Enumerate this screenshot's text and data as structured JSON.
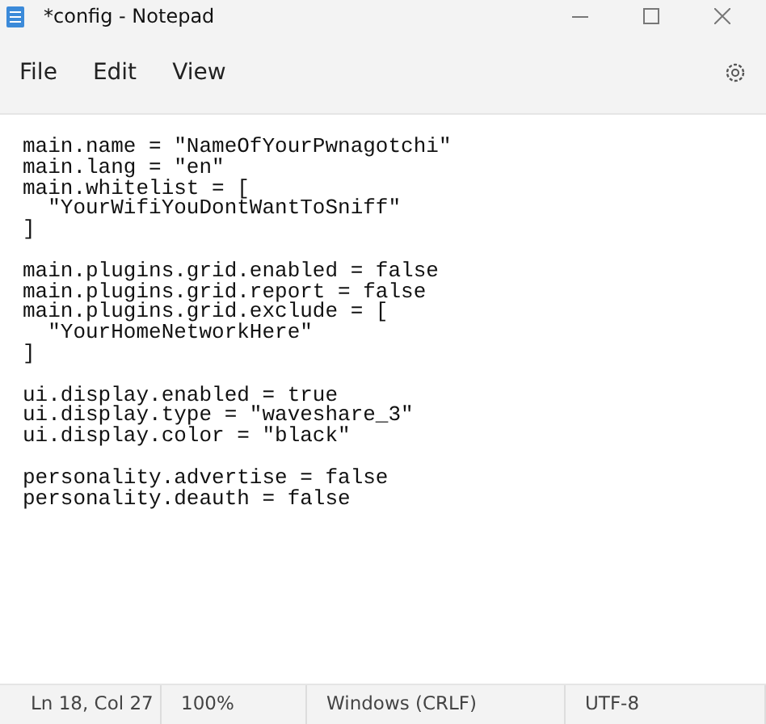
{
  "window": {
    "title": "*config - Notepad"
  },
  "menu": [
    "File",
    "Edit",
    "View"
  ],
  "editor": {
    "blocks": [
      [
        "main.name = \"NameOfYourPwnagotchi\"",
        "main.lang = \"en\"",
        "main.whitelist = [",
        "  \"YourWifiYouDontWantToSniff\"",
        "]"
      ],
      [
        "main.plugins.grid.enabled = false",
        "main.plugins.grid.report = false",
        "main.plugins.grid.exclude = [",
        "  \"YourHomeNetworkHere\"",
        "]"
      ],
      [
        "ui.display.enabled = true",
        "ui.display.type = \"waveshare_3\"",
        "ui.display.color = \"black\""
      ],
      [
        "personality.advertise = false",
        "personality.deauth = false"
      ]
    ]
  },
  "status_bar": [
    "Ln 18, Col 27",
    "100%",
    "Windows (CRLF)",
    "UTF-8"
  ]
}
